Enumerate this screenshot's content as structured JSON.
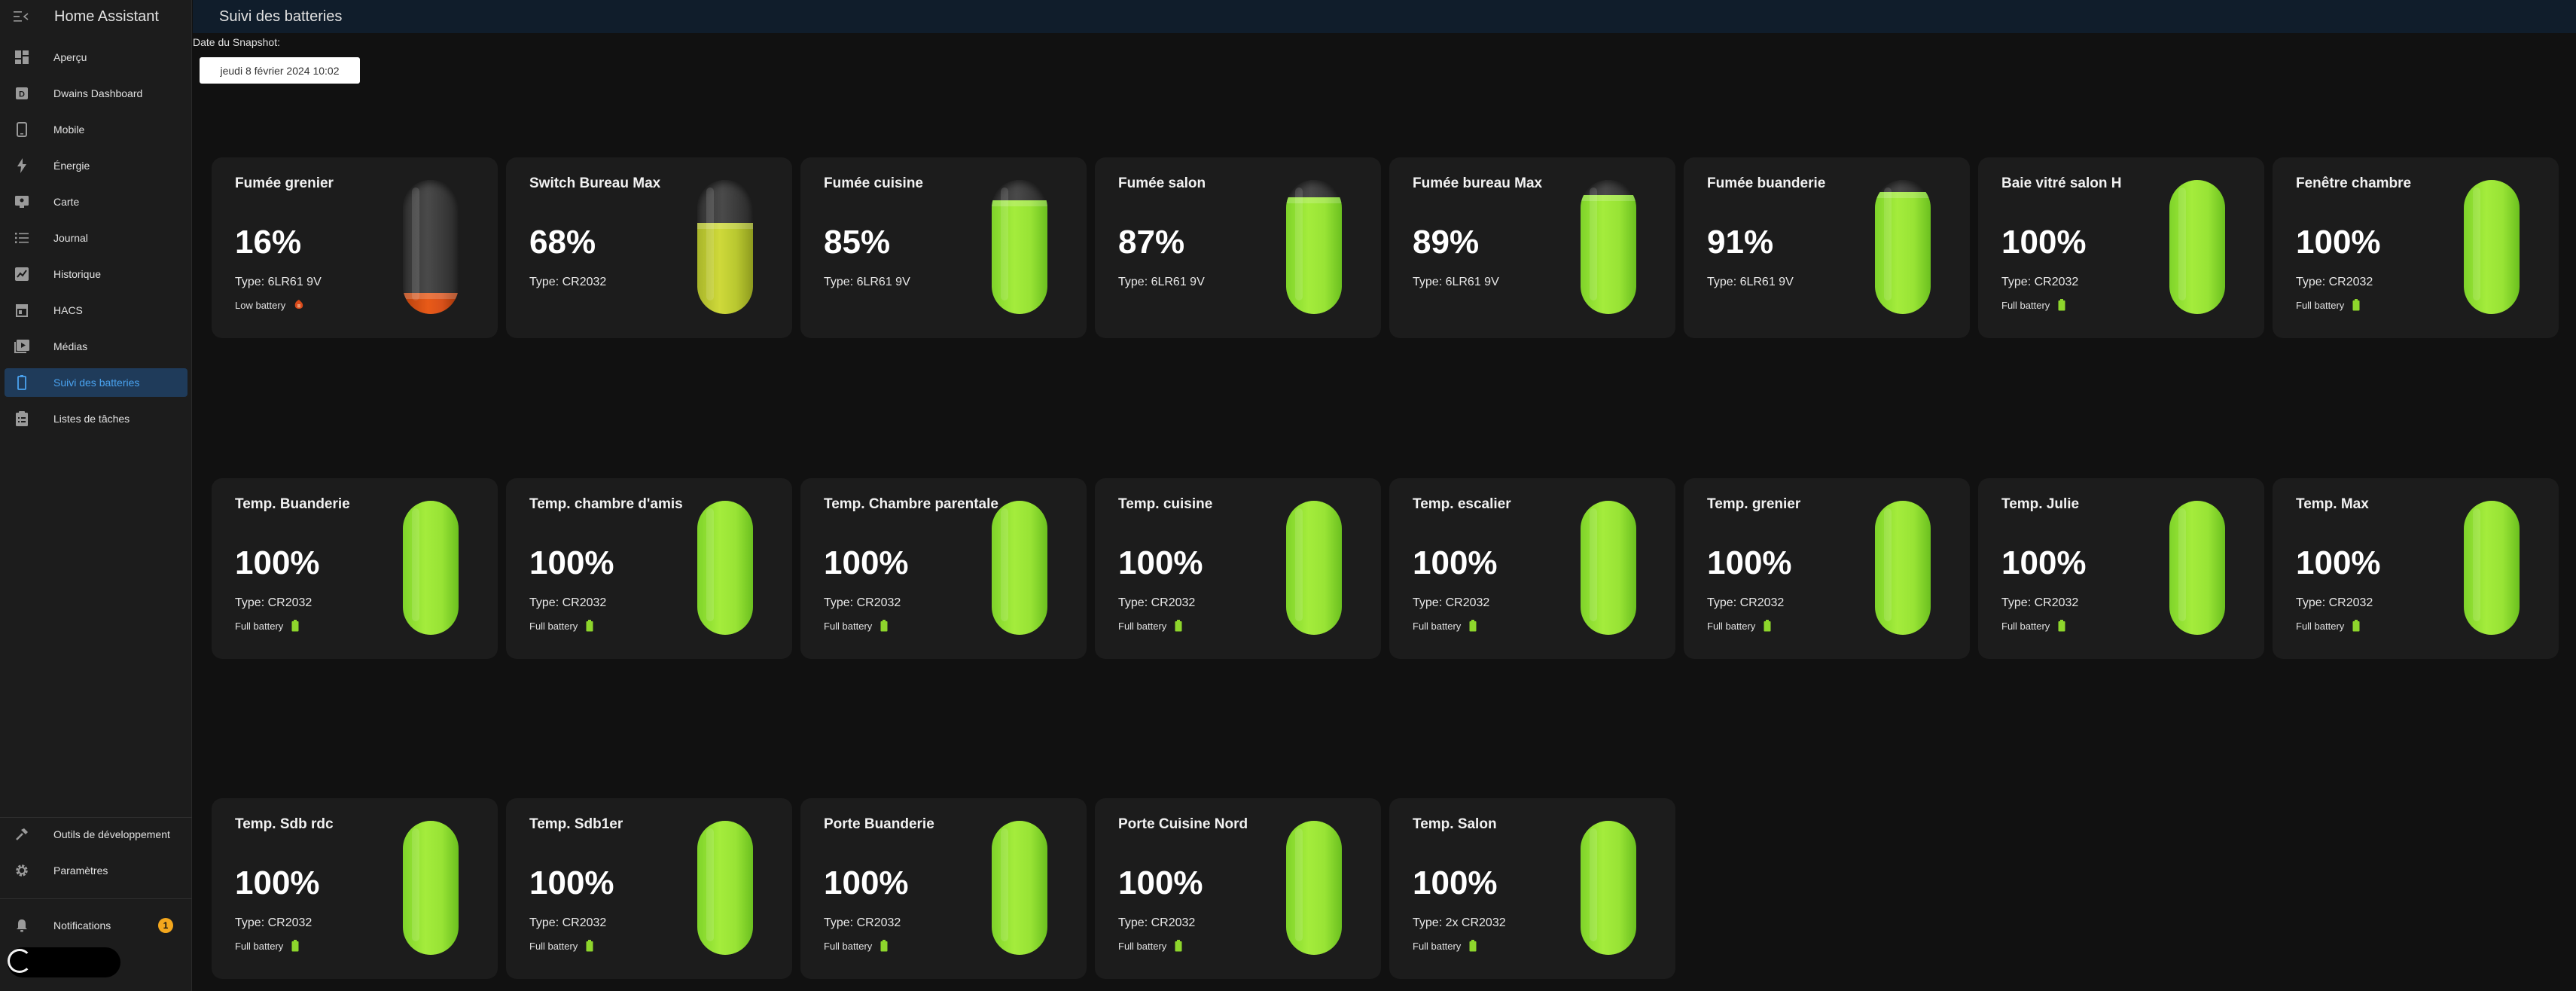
{
  "app": {
    "title": "Home Assistant"
  },
  "page": {
    "title": "Suivi des batteries"
  },
  "sidebar": {
    "items": [
      {
        "label": "Aperçu",
        "icon": "dashboard-icon"
      },
      {
        "label": "Dwains Dashboard",
        "icon": "dwains-dashboard-icon"
      },
      {
        "label": "Mobile",
        "icon": "cellphone-icon"
      },
      {
        "label": "Énergie",
        "icon": "lightning-icon"
      },
      {
        "label": "Carte",
        "icon": "map-icon"
      },
      {
        "label": "Journal",
        "icon": "list-icon"
      },
      {
        "label": "Historique",
        "icon": "chart-icon"
      },
      {
        "label": "HACS",
        "icon": "store-icon"
      },
      {
        "label": "Médias",
        "icon": "media-icon"
      },
      {
        "label": "Suivi des batteries",
        "icon": "battery-icon",
        "active": true
      },
      {
        "label": "Listes de tâches",
        "icon": "clipboard-list-icon"
      }
    ],
    "bottom": {
      "dev_tools": "Outils de développement",
      "settings": "Paramètres",
      "notifications": "Notifications",
      "notification_count": "1"
    }
  },
  "snapshot": {
    "label": "Date du Snapshot:",
    "value": "jeudi 8 février 2024 10:02"
  },
  "accent_color": "#4aa3f0",
  "batteries": [
    {
      "name": "Fumée grenier",
      "percent": "16%",
      "level": 0.16,
      "type": "Type: 6LR61 9V",
      "status": "Low battery",
      "color": "orange",
      "status_icon": "low-battery-icon"
    },
    {
      "name": "Switch Bureau Max",
      "percent": "68%",
      "level": 0.68,
      "type": "Type: CR2032",
      "status": "",
      "color": "yellow"
    },
    {
      "name": "Fumée cuisine",
      "percent": "85%",
      "level": 0.85,
      "type": "Type: 6LR61 9V",
      "status": "",
      "color": "green"
    },
    {
      "name": "Fumée salon",
      "percent": "87%",
      "level": 0.87,
      "type": "Type: 6LR61 9V",
      "status": "",
      "color": "green"
    },
    {
      "name": "Fumée bureau Max",
      "percent": "89%",
      "level": 0.89,
      "type": "Type: 6LR61 9V",
      "status": "",
      "color": "green"
    },
    {
      "name": "Fumée buanderie",
      "percent": "91%",
      "level": 0.91,
      "type": "Type: 6LR61 9V",
      "status": "",
      "color": "green"
    },
    {
      "name": "Baie vitré salon H",
      "percent": "100%",
      "level": 1,
      "type": "Type: CR2032",
      "status": "Full battery",
      "color": "green",
      "status_icon": "full-battery-icon"
    },
    {
      "name": "Fenêtre chambre",
      "percent": "100%",
      "level": 1,
      "type": "Type: CR2032",
      "status": "Full battery",
      "color": "green",
      "status_icon": "full-battery-icon"
    },
    {
      "name": "Temp. Buanderie",
      "percent": "100%",
      "level": 1,
      "type": "Type: CR2032",
      "status": "Full battery",
      "color": "green",
      "status_icon": "full-battery-icon"
    },
    {
      "name": "Temp. chambre d'amis",
      "percent": "100%",
      "level": 1,
      "type": "Type: CR2032",
      "status": "Full battery",
      "color": "green",
      "status_icon": "full-battery-icon"
    },
    {
      "name": "Temp. Chambre parentale",
      "percent": "100%",
      "level": 1,
      "type": "Type: CR2032",
      "status": "Full battery",
      "color": "green",
      "status_icon": "full-battery-icon"
    },
    {
      "name": "Temp. cuisine",
      "percent": "100%",
      "level": 1,
      "type": "Type: CR2032",
      "status": "Full battery",
      "color": "green",
      "status_icon": "full-battery-icon"
    },
    {
      "name": "Temp. escalier",
      "percent": "100%",
      "level": 1,
      "type": "Type: CR2032",
      "status": "Full battery",
      "color": "green",
      "status_icon": "full-battery-icon"
    },
    {
      "name": "Temp. grenier",
      "percent": "100%",
      "level": 1,
      "type": "Type: CR2032",
      "status": "Full battery",
      "color": "green",
      "status_icon": "full-battery-icon"
    },
    {
      "name": "Temp. Julie",
      "percent": "100%",
      "level": 1,
      "type": "Type: CR2032",
      "status": "Full battery",
      "color": "green",
      "status_icon": "full-battery-icon"
    },
    {
      "name": "Temp. Max",
      "percent": "100%",
      "level": 1,
      "type": "Type: CR2032",
      "status": "Full battery",
      "color": "green",
      "status_icon": "full-battery-icon"
    },
    {
      "name": "Temp. Sdb rdc",
      "percent": "100%",
      "level": 1,
      "type": "Type: CR2032",
      "status": "Full battery",
      "color": "green",
      "status_icon": "full-battery-icon"
    },
    {
      "name": "Temp. Sdb1er",
      "percent": "100%",
      "level": 1,
      "type": "Type: CR2032",
      "status": "Full battery",
      "color": "green",
      "status_icon": "full-battery-icon"
    },
    {
      "name": "Porte Buanderie",
      "percent": "100%",
      "level": 1,
      "type": "Type: CR2032",
      "status": "Full battery",
      "color": "green",
      "status_icon": "full-battery-icon"
    },
    {
      "name": "Porte Cuisine Nord",
      "percent": "100%",
      "level": 1,
      "type": "Type: CR2032",
      "status": "Full battery",
      "color": "green",
      "status_icon": "full-battery-icon"
    },
    {
      "name": "Temp. Salon",
      "percent": "100%",
      "level": 1,
      "type": "Type: 2x CR2032",
      "status": "Full battery",
      "color": "green",
      "status_icon": "full-battery-icon"
    }
  ]
}
